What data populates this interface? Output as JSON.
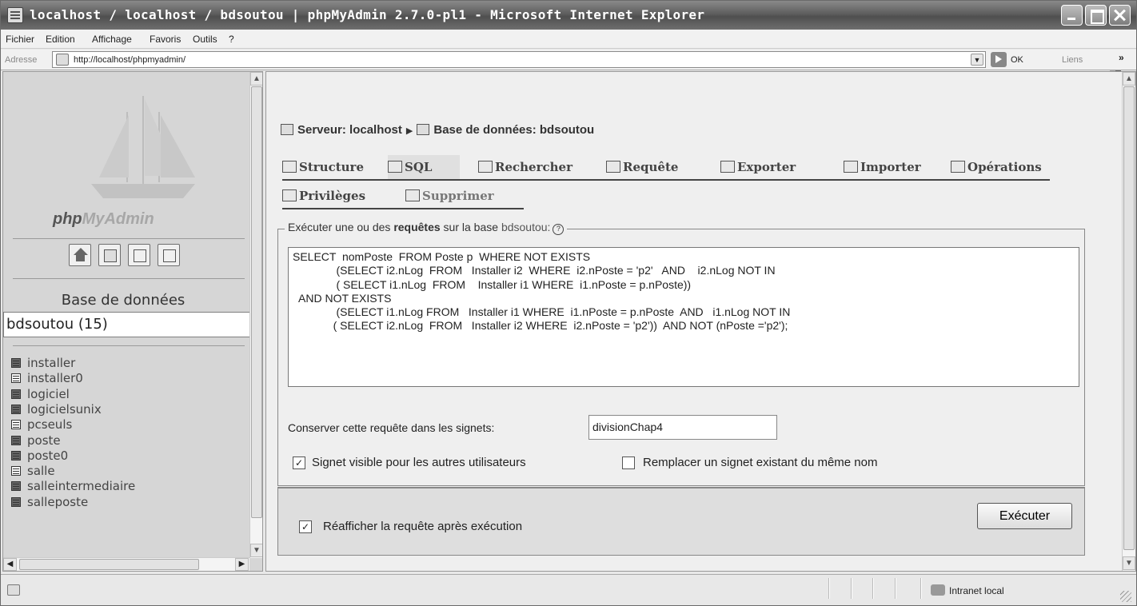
{
  "window": {
    "title": "localhost / localhost / bdsoutou | phpMyAdmin 2.7.0-pl1 - Microsoft Internet Explorer"
  },
  "menu": {
    "items": [
      {
        "label": "Fichier"
      },
      {
        "label": "Edition"
      },
      {
        "label": "Affichage"
      },
      {
        "label": "Favoris"
      },
      {
        "label": "Outils"
      },
      {
        "label": "?"
      }
    ]
  },
  "address_bar": {
    "label": "Adresse",
    "url": "http://localhost/phpmyadmin/",
    "go_label": "OK",
    "links_label": "Liens",
    "links_chevron": "»"
  },
  "left": {
    "logo_php": "php",
    "logo_mya": "MyAdmin",
    "nav_icons": [
      "home-icon",
      "sql-icon",
      "query-window-icon",
      "documentation-icon"
    ],
    "db_label": "Base de données",
    "db_selected": "bdsoutou (15)",
    "tables": [
      {
        "name": "installer",
        "icon": "table-icon"
      },
      {
        "name": "installer0",
        "icon": "table-icon"
      },
      {
        "name": "logiciel",
        "icon": "table-icon"
      },
      {
        "name": "logicielsunix",
        "icon": "table-icon"
      },
      {
        "name": "pcseuls",
        "icon": "table-icon"
      },
      {
        "name": "poste",
        "icon": "table-icon"
      },
      {
        "name": "poste0",
        "icon": "table-icon"
      },
      {
        "name": "salle",
        "icon": "table-icon"
      },
      {
        "name": "salleintermediaire",
        "icon": "table-icon"
      },
      {
        "name": "salleposte",
        "icon": "table-icon"
      }
    ]
  },
  "main": {
    "breadcrumb": {
      "server": "Serveur: localhost",
      "separator": "▶",
      "database": "Base de données: bdsoutou"
    },
    "tabs": [
      {
        "label": "Structure",
        "icon": "structure-icon"
      },
      {
        "label": "SQL",
        "icon": "sql-icon",
        "active": true
      },
      {
        "label": "Rechercher",
        "icon": "search-icon"
      },
      {
        "label": "Requête",
        "icon": "query-icon"
      },
      {
        "label": "Exporter",
        "icon": "export-icon"
      },
      {
        "label": "Importer",
        "icon": "import-icon"
      },
      {
        "label": "Opérations",
        "icon": "operations-icon"
      },
      {
        "label": "Privilèges",
        "icon": "privileges-icon"
      },
      {
        "label": "Supprimer",
        "icon": "drop-icon"
      }
    ],
    "legend_prefix": "Exécuter une ou des ",
    "legend_bold": "requêtes",
    "legend_mid": " sur la base ",
    "legend_db": "bdsoutou:",
    "help_glyph": "?",
    "sql": "SELECT  nomPoste  FROM Poste p  WHERE NOT EXISTS\n              (SELECT i2.nLog  FROM   Installer i2  WHERE  i2.nPoste = 'p2'   AND    i2.nLog NOT IN\n              ( SELECT i1.nLog  FROM    Installer i1 WHERE  i1.nPoste = p.nPoste))\n  AND NOT EXISTS\n              (SELECT i1.nLog FROM   Installer i1 WHERE  i1.nPoste = p.nPoste  AND   i1.nLog NOT IN\n             ( SELECT i2.nLog  FROM   Installer i2 WHERE  i2.nPoste = 'p2'))  AND NOT (nPoste ='p2');",
    "bookmark_label": "Conserver cette requête dans les signets:",
    "bookmark_value": "divisionChap4",
    "signet_visible_label": "Signet visible pour les autres utilisateurs",
    "signet_visible_checked": true,
    "replace_label": "Remplacer un signet existant du même nom",
    "replace_checked": false,
    "redisplay_label": "Réafficher la requête après exécution",
    "redisplay_checked": true,
    "execute_label": "Exécuter"
  },
  "status": {
    "zone": "Intranet local"
  }
}
